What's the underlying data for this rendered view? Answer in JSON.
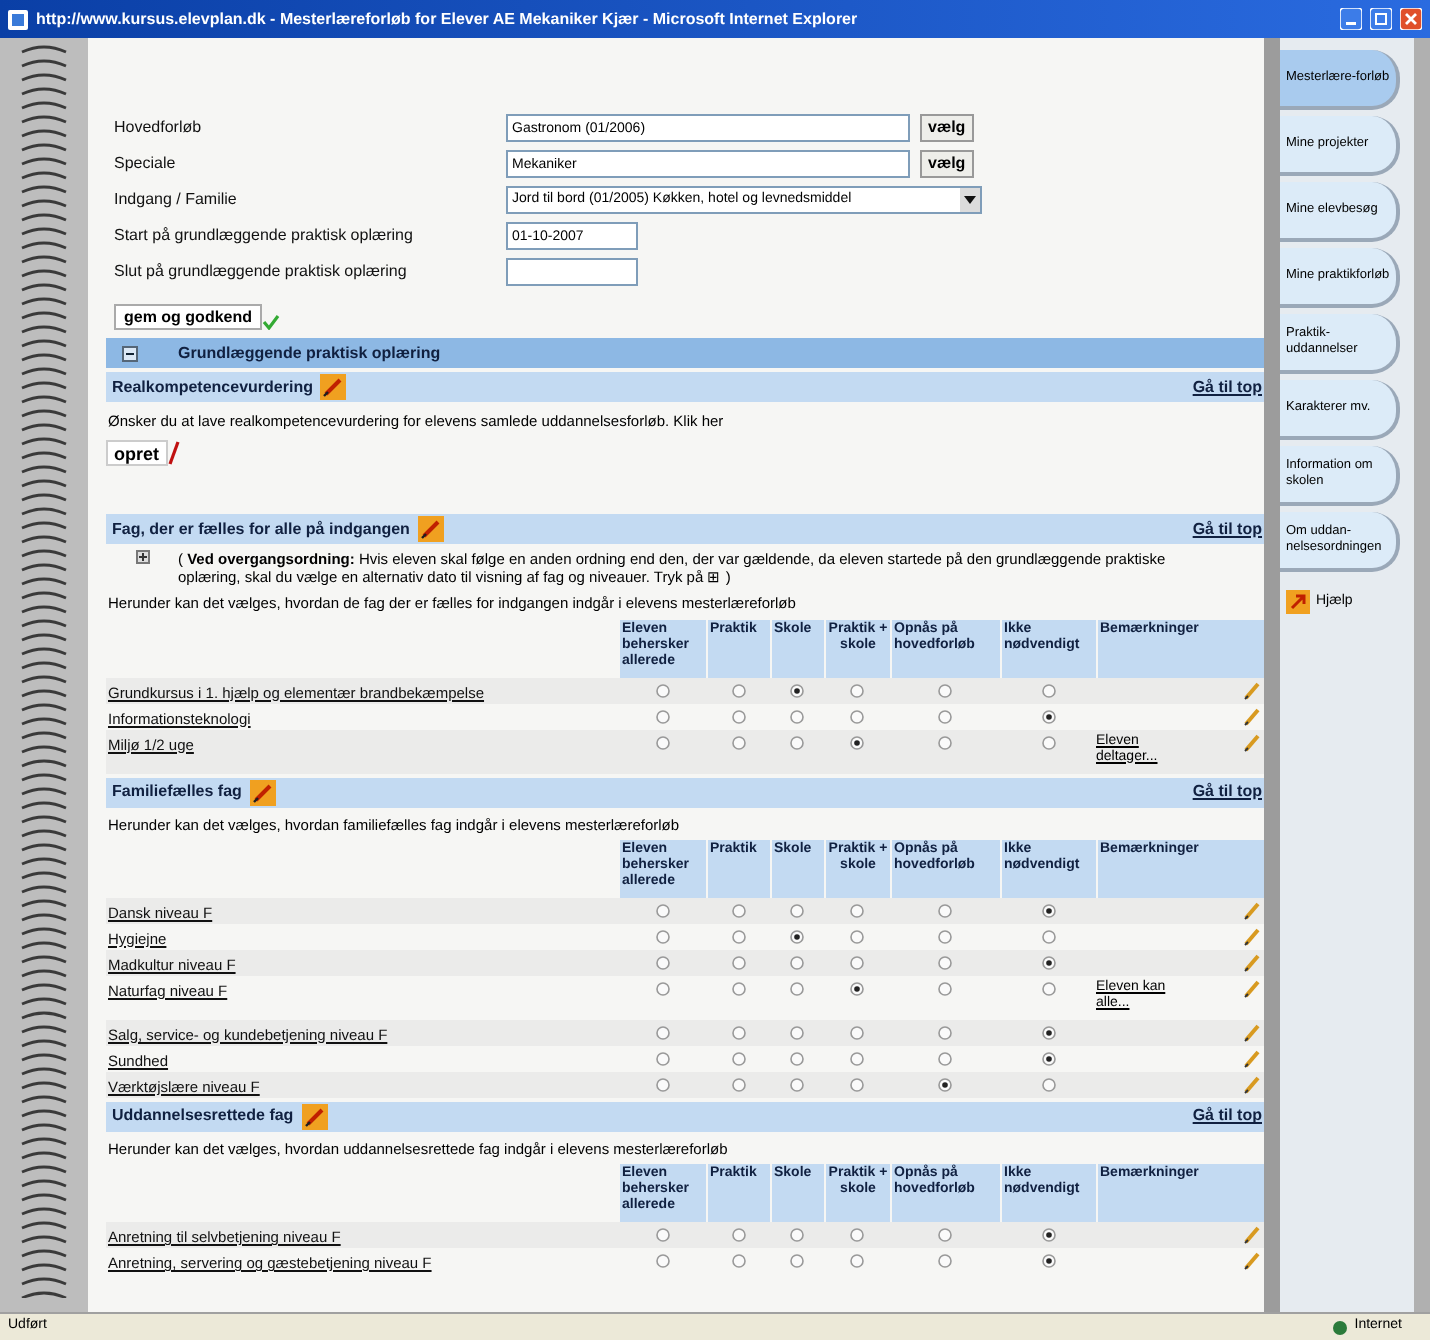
{
  "window": {
    "title": "http://www.kursus.elevplan.dk - Mesterlæreforløb for Elever AE Mekaniker Kjær - Microsoft Internet Explorer"
  },
  "form": {
    "fields": [
      {
        "label": "Hovedforløb",
        "kind": "text",
        "value": "Gastronom (01/2006)",
        "button": "vælg"
      },
      {
        "label": "Speciale",
        "kind": "text",
        "value": "Mekaniker",
        "button": "vælg"
      },
      {
        "label": "Indgang / Familie",
        "kind": "select",
        "value": "Jord til bord (01/2005) Køkken, hotel og levnedsmiddel"
      },
      {
        "label": "Start på grundlæggende praktisk oplæring",
        "kind": "date",
        "value": "01-10-2007"
      },
      {
        "label": "Slut på grundlæggende praktisk oplæring",
        "kind": "date"
      }
    ],
    "submit": "gem og godkend"
  },
  "group": {
    "title": "Grundlæggende praktisk oplæring",
    "expanded": true
  },
  "sections": [
    {
      "kind": "action",
      "title": "Realkompetencevurdering",
      "top_link": "Gå til top",
      "text": "Ønsker du at lave realkompetencevurdering for elevens samlede uddannelsesforløb. Klik her",
      "button": "opret"
    },
    {
      "kind": "table",
      "title": "Fag, der er fælles for alle på indgangen",
      "top_link": "Gå til top",
      "note": "( **Ved overgangsordning:** Hvis eleven skal følge en anden ordning end den, der var gældende, da eleven startede på den grundlæggende praktiske oplæring, skal du vælge en alternativ dato til visning af fag og niveauer. Tryk på ⊞ )",
      "intro": "Herunder kan det vælges, hvordan de fag der er fælles for indgangen indgår i elevens mesterlæreforløb",
      "columns": [
        "Eleven behersker allerede",
        "Praktik",
        "Skole",
        "Praktik + skole",
        "Opnås på hovedforløb",
        "Ikke nødvendigt",
        "Bemærkninger"
      ],
      "rows": [
        {
          "name": "Grundkursus i 1. hjælp og elementær brandbekæmpelse",
          "options": [
            {
              "selected": false
            },
            {
              "selected": false
            },
            {
              "selected": true
            },
            {
              "selected": false
            },
            {
              "selected": false
            },
            {
              "selected": false
            }
          ]
        },
        {
          "name": "Informationsteknologi",
          "options": [
            {
              "selected": false
            },
            {
              "selected": false
            },
            {
              "selected": false
            },
            {
              "selected": false
            },
            {
              "selected": false
            },
            {
              "selected": true
            }
          ]
        },
        {
          "name": "Miljø 1/2 uge",
          "options": [
            {
              "selected": false
            },
            {
              "selected": false
            },
            {
              "selected": false
            },
            {
              "selected": true
            },
            {
              "selected": false
            },
            {
              "selected": false
            }
          ],
          "remark": "Eleven deltager..."
        }
      ]
    },
    {
      "kind": "table",
      "title": "Familiefælles fag",
      "top_link": "Gå til top",
      "intro": "Herunder kan det vælges, hvordan familiefælles fag indgår i elevens mesterlæreforløb",
      "columns": [
        "Eleven behersker allerede",
        "Praktik",
        "Skole",
        "Praktik + skole",
        "Opnås på hovedforløb",
        "Ikke nødvendigt",
        "Bemærkninger"
      ],
      "rows": [
        {
          "name": "Dansk niveau F",
          "options": [
            {
              "selected": false
            },
            {
              "selected": false
            },
            {
              "selected": false
            },
            {
              "selected": false
            },
            {
              "selected": false
            },
            {
              "selected": true
            }
          ]
        },
        {
          "name": "Hygiejne",
          "options": [
            {
              "selected": false
            },
            {
              "selected": false
            },
            {
              "selected": true
            },
            {
              "selected": false
            },
            {
              "selected": false
            },
            {
              "selected": false
            }
          ]
        },
        {
          "name": "Madkultur niveau F",
          "options": [
            {
              "selected": false
            },
            {
              "selected": false
            },
            {
              "selected": false
            },
            {
              "selected": false
            },
            {
              "selected": false
            },
            {
              "selected": true
            }
          ]
        },
        {
          "name": "Naturfag niveau F",
          "options": [
            {
              "selected": false
            },
            {
              "selected": false
            },
            {
              "selected": false
            },
            {
              "selected": true
            },
            {
              "selected": false
            },
            {
              "selected": false
            }
          ],
          "remark": "Eleven kan alle..."
        },
        {
          "name": "Salg, service- og kundebetjening niveau F",
          "options": [
            {
              "selected": false
            },
            {
              "selected": false
            },
            {
              "selected": false
            },
            {
              "selected": false
            },
            {
              "selected": false
            },
            {
              "selected": true
            }
          ]
        },
        {
          "name": "Sundhed",
          "options": [
            {
              "selected": false
            },
            {
              "selected": false
            },
            {
              "selected": false
            },
            {
              "selected": false
            },
            {
              "selected": false
            },
            {
              "selected": true
            }
          ]
        },
        {
          "name": "Værktøjslære niveau F",
          "options": [
            {
              "selected": false
            },
            {
              "selected": false
            },
            {
              "selected": false
            },
            {
              "selected": false
            },
            {
              "selected": true
            },
            {
              "selected": false
            }
          ]
        }
      ]
    },
    {
      "kind": "table",
      "title": "Uddannelsesrettede fag",
      "top_link": "Gå til top",
      "intro": "Herunder kan det vælges, hvordan uddannelsesrettede fag indgår i elevens mesterlæreforløb",
      "columns": [
        "Eleven behersker allerede",
        "Praktik",
        "Skole",
        "Praktik + skole",
        "Opnås på hovedforløb",
        "Ikke nødvendigt",
        "Bemærkninger"
      ],
      "rows": [
        {
          "name": "Anretning til selvbetjening niveau F",
          "options": [
            {
              "selected": false
            },
            {
              "selected": false
            },
            {
              "selected": false
            },
            {
              "selected": false
            },
            {
              "selected": false
            },
            {
              "selected": true
            }
          ]
        },
        {
          "name": "Anretning, servering og gæstebetjening niveau F",
          "options": [
            {
              "selected": false
            },
            {
              "selected": false
            },
            {
              "selected": false
            },
            {
              "selected": false
            },
            {
              "selected": false
            },
            {
              "selected": true
            }
          ]
        }
      ]
    }
  ],
  "sidebar": {
    "items": [
      {
        "label": "Mesterlære-forløb",
        "selected": true
      },
      {
        "label": "Mine projekter",
        "selected": false
      },
      {
        "label": "Mine elevbesøg",
        "selected": false
      },
      {
        "label": "Mine praktikforløb",
        "selected": false
      },
      {
        "label": "Praktik-uddannelser",
        "selected": false
      },
      {
        "label": "Karakterer mv.",
        "selected": false
      },
      {
        "label": "Information om skolen",
        "selected": false
      },
      {
        "label": "Om uddan-nelsesordningen",
        "selected": false
      }
    ],
    "help": "Hjælp"
  },
  "status_bar": {
    "left": "Udført",
    "right": "Internet"
  }
}
